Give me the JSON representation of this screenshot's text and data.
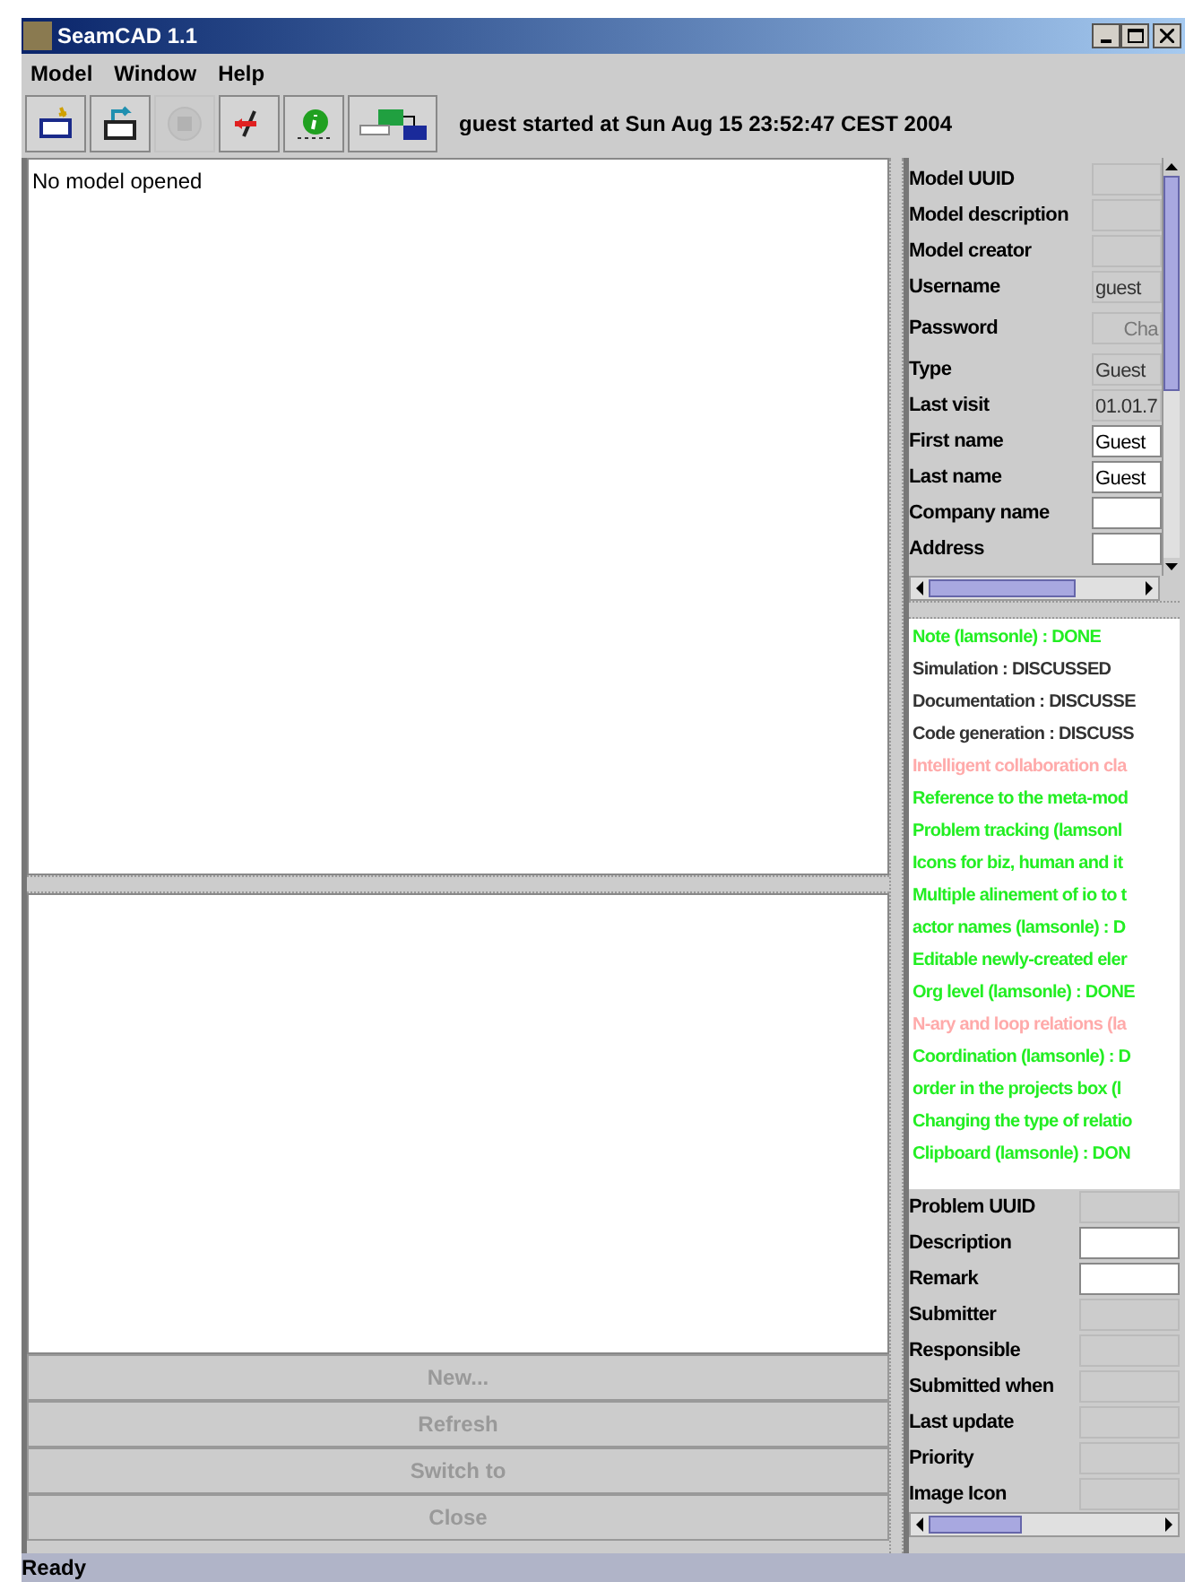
{
  "window": {
    "title": "SeamCAD 1.1"
  },
  "menu": [
    "Model",
    "Window",
    "Help"
  ],
  "toolbar": [
    {
      "kind": "new",
      "disabled": false
    },
    {
      "kind": "open",
      "disabled": false
    },
    {
      "kind": "save",
      "disabled": true
    },
    {
      "kind": "exit",
      "disabled": false
    },
    {
      "kind": "info",
      "disabled": false
    },
    {
      "kind": "meta",
      "disabled": false
    }
  ],
  "toolbar_message": "guest started at Sun Aug 15 23:52:47 CEST 2004",
  "model_panel": {
    "text": "No model opened"
  },
  "project_buttons": [
    {
      "label": "New...",
      "disabled": true
    },
    {
      "label": "Refresh",
      "disabled": true
    },
    {
      "label": "Switch to",
      "disabled": true
    },
    {
      "label": "Close",
      "disabled": true
    }
  ],
  "user_properties": [
    {
      "label": "Model UUID",
      "kind": "readonly"
    },
    {
      "label": "Model description",
      "kind": "readonly"
    },
    {
      "label": "Model creator",
      "kind": "readonly"
    },
    {
      "label": "Username",
      "kind": "readonly",
      "value": "guest"
    },
    {
      "label": "Password",
      "kind": "button",
      "value": "Cha"
    },
    {
      "label": "Type",
      "kind": "readonly",
      "value": "Guest"
    },
    {
      "label": "Last visit",
      "kind": "readonly",
      "value": "01.01.7"
    },
    {
      "label": "First name",
      "kind": "editable",
      "value": "Guest"
    },
    {
      "label": "Last name",
      "kind": "editable",
      "value": "Guest"
    },
    {
      "label": "Company name",
      "kind": "editable"
    },
    {
      "label": "Address",
      "kind": "editable"
    }
  ],
  "problems": [
    {
      "text": "Note (lamsonle) : DONE",
      "color": "#22ee22"
    },
    {
      "text": "Simulation : DISCUSSED",
      "color": "#333333"
    },
    {
      "text": "Documentation : DISCUSSE",
      "color": "#333333"
    },
    {
      "text": "Code generation : DISCUSS",
      "color": "#333333"
    },
    {
      "text": "Intelligent collaboration cla",
      "color": "#ffaaaa"
    },
    {
      "text": "Reference to the meta-mod",
      "color": "#22ee22"
    },
    {
      "text": "Problem tracking (lamsonl",
      "color": "#22ee22"
    },
    {
      "text": "Icons for biz, human and it",
      "color": "#22ee22"
    },
    {
      "text": "Multiple alinement of io to t",
      "color": "#22ee22"
    },
    {
      "text": "actor names (lamsonle) : D",
      "color": "#22ee22"
    },
    {
      "text": "Editable newly-created eler",
      "color": "#22ee22"
    },
    {
      "text": "Org level (lamsonle) : DONE",
      "color": "#22ee22"
    },
    {
      "text": "N-ary and loop relations (la",
      "color": "#ffaaaa"
    },
    {
      "text": "Coordination (lamsonle) : D",
      "color": "#22ee22"
    },
    {
      "text": "order in the projects box (l",
      "color": "#22ee22"
    },
    {
      "text": "Changing the type of relatio",
      "color": "#22ee22"
    },
    {
      "text": "Clipboard (lamsonle) : DON",
      "color": "#22ee22"
    }
  ],
  "problem_properties": [
    {
      "label": "Problem UUID",
      "kind": "readonly"
    },
    {
      "label": "Description",
      "kind": "editable"
    },
    {
      "label": "Remark",
      "kind": "editable"
    },
    {
      "label": "Submitter",
      "kind": "readonly"
    },
    {
      "label": "Responsible",
      "kind": "readonly"
    },
    {
      "label": "Submitted when",
      "kind": "readonly"
    },
    {
      "label": "Last update",
      "kind": "readonly"
    },
    {
      "label": "Priority",
      "kind": "readonly"
    },
    {
      "label": "Image Icon",
      "kind": "readonly"
    }
  ],
  "status_bar": "Ready"
}
